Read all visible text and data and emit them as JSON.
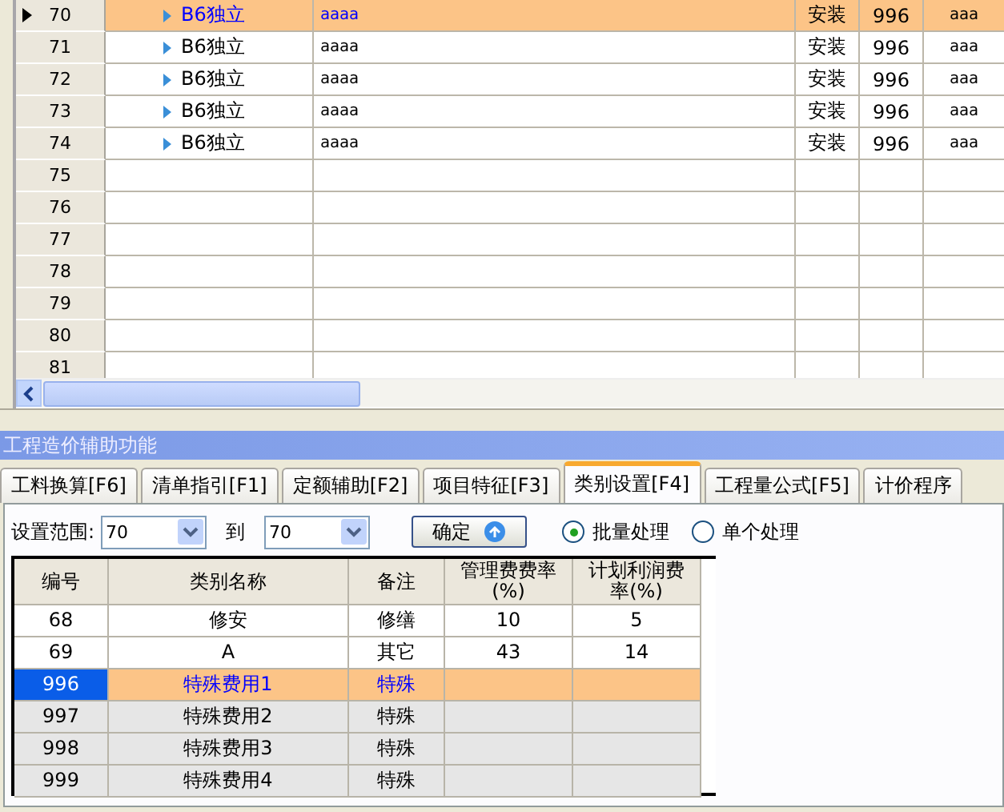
{
  "grid": {
    "rows": [
      {
        "number": "70",
        "selected": true,
        "name": "B6独立",
        "column_3": "aaaa",
        "column_4": "安装",
        "column_5": "996",
        "column_6": "aaa"
      },
      {
        "number": "71",
        "selected": false,
        "name": "B6独立",
        "column_3": "aaaa",
        "column_4": "安装",
        "column_5": "996",
        "column_6": "aaa"
      },
      {
        "number": "72",
        "selected": false,
        "name": "B6独立",
        "column_3": "aaaa",
        "column_4": "安装",
        "column_5": "996",
        "column_6": "aaa"
      },
      {
        "number": "73",
        "selected": false,
        "name": "B6独立",
        "column_3": "aaaa",
        "column_4": "安装",
        "column_5": "996",
        "column_6": "aaa"
      },
      {
        "number": "74",
        "selected": false,
        "name": "B6独立",
        "column_3": "aaaa",
        "column_4": "安装",
        "column_5": "996",
        "column_6": "aaa"
      },
      {
        "number": "75",
        "selected": false
      },
      {
        "number": "76",
        "selected": false
      },
      {
        "number": "77",
        "selected": false
      },
      {
        "number": "78",
        "selected": false
      },
      {
        "number": "79",
        "selected": false
      },
      {
        "number": "80",
        "selected": false
      },
      {
        "number": "81",
        "selected": false
      }
    ]
  },
  "panel": {
    "title": "工程造价辅助功能",
    "tabs": [
      {
        "label": "工料换算[F6]",
        "selected": false
      },
      {
        "label": "清单指引[F1]",
        "selected": false
      },
      {
        "label": "定额辅助[F2]",
        "selected": false
      },
      {
        "label": "项目特征[F3]",
        "selected": false
      },
      {
        "label": "类别设置[F4]",
        "selected": true
      },
      {
        "label": "工程量公式[F5]",
        "selected": false
      },
      {
        "label": "计价程序",
        "selected": false
      }
    ],
    "range_label": "设置范围:",
    "range_from": "70",
    "to_label": "到",
    "range_to": "70",
    "confirm_button": "确定",
    "modes": [
      {
        "label": "批量处理",
        "selected": true
      },
      {
        "label": "单个处理",
        "selected": false
      }
    ],
    "table": {
      "columns": [
        "编号",
        "类别名称",
        "备注",
        "管理费费率(%)",
        "计划利润费率(%)"
      ],
      "rows": [
        {
          "cells": [
            "68",
            "修安",
            "修缮",
            "10",
            "5"
          ],
          "selected": false,
          "readonly": false
        },
        {
          "cells": [
            "69",
            "A",
            "其它",
            "43",
            "14"
          ],
          "selected": false,
          "readonly": false
        },
        {
          "cells": [
            "996",
            "特殊费用1",
            "特殊",
            "",
            ""
          ],
          "selected": true,
          "readonly": true
        },
        {
          "cells": [
            "997",
            "特殊费用2",
            "特殊",
            "",
            ""
          ],
          "selected": false,
          "readonly": true
        },
        {
          "cells": [
            "998",
            "特殊费用3",
            "特殊",
            "",
            ""
          ],
          "selected": false,
          "readonly": true
        },
        {
          "cells": [
            "999",
            "特殊费用4",
            "特殊",
            "",
            ""
          ],
          "selected": false,
          "readonly": true
        }
      ]
    }
  }
}
